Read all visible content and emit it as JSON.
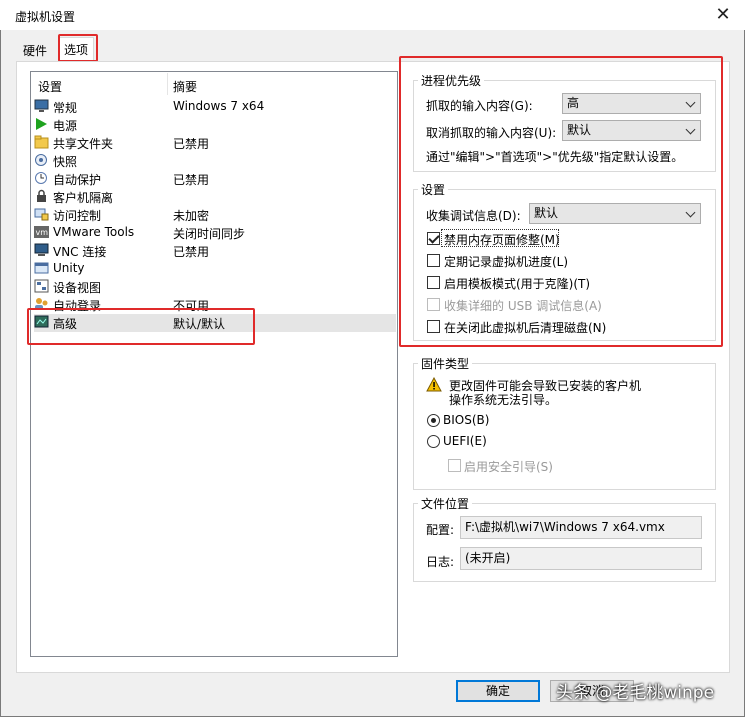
{
  "window": {
    "title": "虚拟机设置"
  },
  "tabs": [
    "硬件",
    "选项"
  ],
  "list": {
    "headers": {
      "setting": "设置",
      "summary": "摘要"
    },
    "items": [
      {
        "name": "常规",
        "summary": "Windows 7 x64",
        "icon": "monitor-icon"
      },
      {
        "name": "电源",
        "summary": "",
        "icon": "play-icon"
      },
      {
        "name": "共享文件夹",
        "summary": "已禁用",
        "icon": "shared-folder-icon"
      },
      {
        "name": "快照",
        "summary": "",
        "icon": "snapshot-icon"
      },
      {
        "name": "自动保护",
        "summary": "已禁用",
        "icon": "clock-icon"
      },
      {
        "name": "客户机隔离",
        "summary": "",
        "icon": "lock-icon"
      },
      {
        "name": "访问控制",
        "summary": "未加密",
        "icon": "access-control-icon"
      },
      {
        "name": "VMware Tools",
        "summary": "关闭时间同步",
        "icon": "vm-icon"
      },
      {
        "name": "VNC 连接",
        "summary": "已禁用",
        "icon": "vnc-icon"
      },
      {
        "name": "Unity",
        "summary": "",
        "icon": "unity-icon"
      },
      {
        "name": "设备视图",
        "summary": "",
        "icon": "device-view-icon"
      },
      {
        "name": "自动登录",
        "summary": "不可用",
        "icon": "users-icon"
      },
      {
        "name": "高级",
        "summary": "默认/默认",
        "icon": "advanced-icon"
      }
    ]
  },
  "priority": {
    "legend": "进程优先级",
    "grabbed_label": "抓取的输入内容(G):",
    "grabbed_value": "高",
    "ungrabbed_label": "取消抓取的输入内容(U):",
    "ungrabbed_value": "默认",
    "hint": "通过\"编辑\">\"首选项\">\"优先级\"指定默认设置。"
  },
  "settings": {
    "legend": "设置",
    "debug_label": "收集调试信息(D):",
    "debug_value": "默认",
    "checkboxes": [
      {
        "label": "禁用内存页面修整(M)",
        "checked": true,
        "enabled": true
      },
      {
        "label": "定期记录虚拟机进度(L)",
        "checked": false,
        "enabled": true
      },
      {
        "label": "启用模板模式(用于克隆)(T)",
        "checked": false,
        "enabled": true
      },
      {
        "label": "收集详细的 USB 调试信息(A)",
        "checked": false,
        "enabled": false
      },
      {
        "label": "在关闭此虚拟机后清理磁盘(N)",
        "checked": false,
        "enabled": true
      }
    ]
  },
  "firmware": {
    "legend": "固件类型",
    "warning_line1": "更改固件可能会导致已安装的客户机",
    "warning_line2": "操作系统无法引导。",
    "bios_label": "BIOS(B)",
    "uefi_label": "UEFI(E)",
    "secure_boot_label": "启用安全引导(S)",
    "selected": "BIOS"
  },
  "file_location": {
    "legend": "文件位置",
    "config_label": "配置:",
    "config_value": "F:\\虚拟机\\wi7\\Windows 7 x64.vmx",
    "log_label": "日志:",
    "log_value": "(未开启)"
  },
  "buttons": {
    "ok": "确定",
    "cancel": "取消"
  },
  "watermark": "头条 @老毛桃winpe",
  "colors": {
    "highlight_box": "#e02a2a",
    "default_button": "#0078d7",
    "warning": "#f5c000"
  }
}
